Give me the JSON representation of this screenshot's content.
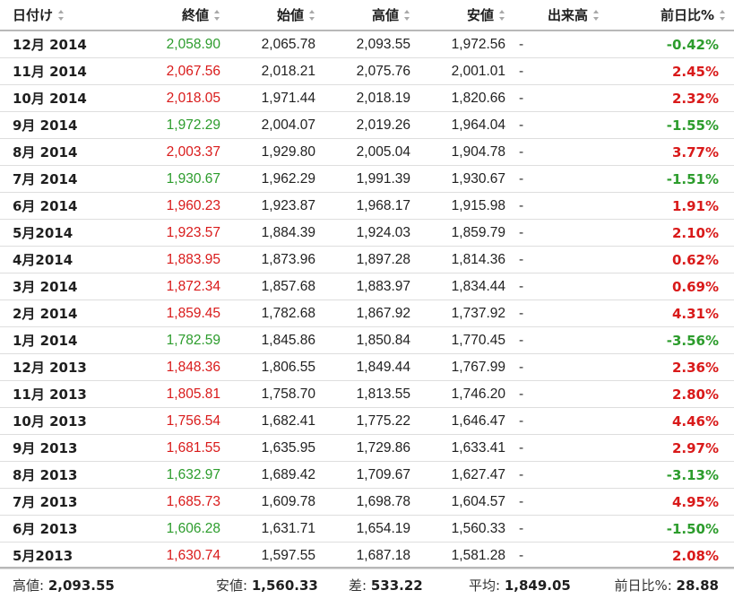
{
  "header": {
    "date": "日付け",
    "close": "終値",
    "open": "始値",
    "high": "高値",
    "low": "安値",
    "volume": "出来高",
    "change": "前日比%"
  },
  "rows": [
    {
      "date": "12月 2014",
      "close": "2,058.90",
      "open": "2,065.78",
      "high": "2,093.55",
      "low": "1,972.56",
      "volume": "-",
      "change": "-0.42%",
      "dir": "down"
    },
    {
      "date": "11月 2014",
      "close": "2,067.56",
      "open": "2,018.21",
      "high": "2,075.76",
      "low": "2,001.01",
      "volume": "-",
      "change": "2.45%",
      "dir": "up"
    },
    {
      "date": "10月 2014",
      "close": "2,018.05",
      "open": "1,971.44",
      "high": "2,018.19",
      "low": "1,820.66",
      "volume": "-",
      "change": "2.32%",
      "dir": "up"
    },
    {
      "date": "9月 2014",
      "close": "1,972.29",
      "open": "2,004.07",
      "high": "2,019.26",
      "low": "1,964.04",
      "volume": "-",
      "change": "-1.55%",
      "dir": "down"
    },
    {
      "date": "8月 2014",
      "close": "2,003.37",
      "open": "1,929.80",
      "high": "2,005.04",
      "low": "1,904.78",
      "volume": "-",
      "change": "3.77%",
      "dir": "up"
    },
    {
      "date": "7月 2014",
      "close": "1,930.67",
      "open": "1,962.29",
      "high": "1,991.39",
      "low": "1,930.67",
      "volume": "-",
      "change": "-1.51%",
      "dir": "down"
    },
    {
      "date": "6月 2014",
      "close": "1,960.23",
      "open": "1,923.87",
      "high": "1,968.17",
      "low": "1,915.98",
      "volume": "-",
      "change": "1.91%",
      "dir": "up"
    },
    {
      "date": "5月2014",
      "close": "1,923.57",
      "open": "1,884.39",
      "high": "1,924.03",
      "low": "1,859.79",
      "volume": "-",
      "change": "2.10%",
      "dir": "up"
    },
    {
      "date": "4月2014",
      "close": "1,883.95",
      "open": "1,873.96",
      "high": "1,897.28",
      "low": "1,814.36",
      "volume": "-",
      "change": "0.62%",
      "dir": "up"
    },
    {
      "date": "3月 2014",
      "close": "1,872.34",
      "open": "1,857.68",
      "high": "1,883.97",
      "low": "1,834.44",
      "volume": "-",
      "change": "0.69%",
      "dir": "up"
    },
    {
      "date": "2月 2014",
      "close": "1,859.45",
      "open": "1,782.68",
      "high": "1,867.92",
      "low": "1,737.92",
      "volume": "-",
      "change": "4.31%",
      "dir": "up"
    },
    {
      "date": "1月 2014",
      "close": "1,782.59",
      "open": "1,845.86",
      "high": "1,850.84",
      "low": "1,770.45",
      "volume": "-",
      "change": "-3.56%",
      "dir": "down"
    },
    {
      "date": "12月 2013",
      "close": "1,848.36",
      "open": "1,806.55",
      "high": "1,849.44",
      "low": "1,767.99",
      "volume": "-",
      "change": "2.36%",
      "dir": "up"
    },
    {
      "date": "11月 2013",
      "close": "1,805.81",
      "open": "1,758.70",
      "high": "1,813.55",
      "low": "1,746.20",
      "volume": "-",
      "change": "2.80%",
      "dir": "up"
    },
    {
      "date": "10月 2013",
      "close": "1,756.54",
      "open": "1,682.41",
      "high": "1,775.22",
      "low": "1,646.47",
      "volume": "-",
      "change": "4.46%",
      "dir": "up"
    },
    {
      "date": "9月 2013",
      "close": "1,681.55",
      "open": "1,635.95",
      "high": "1,729.86",
      "low": "1,633.41",
      "volume": "-",
      "change": "2.97%",
      "dir": "up"
    },
    {
      "date": "8月 2013",
      "close": "1,632.97",
      "open": "1,689.42",
      "high": "1,709.67",
      "low": "1,627.47",
      "volume": "-",
      "change": "-3.13%",
      "dir": "down"
    },
    {
      "date": "7月 2013",
      "close": "1,685.73",
      "open": "1,609.78",
      "high": "1,698.78",
      "low": "1,604.57",
      "volume": "-",
      "change": "4.95%",
      "dir": "up"
    },
    {
      "date": "6月 2013",
      "close": "1,606.28",
      "open": "1,631.71",
      "high": "1,654.19",
      "low": "1,560.33",
      "volume": "-",
      "change": "-1.50%",
      "dir": "down"
    },
    {
      "date": "5月2013",
      "close": "1,630.74",
      "open": "1,597.55",
      "high": "1,687.18",
      "low": "1,581.28",
      "volume": "-",
      "change": "2.08%",
      "dir": "up"
    }
  ],
  "summary": {
    "high_label": "高値:",
    "high_value": "2,093.55",
    "low_label": "安値:",
    "low_value": "1,560.33",
    "diff_label": "差:",
    "diff_value": "533.22",
    "avg_label": "平均:",
    "avg_value": "1,849.05",
    "change_label": "前日比%:",
    "change_value": "28.88"
  },
  "colors": {
    "up": "#d91a1a",
    "down": "#2c9c2c"
  }
}
